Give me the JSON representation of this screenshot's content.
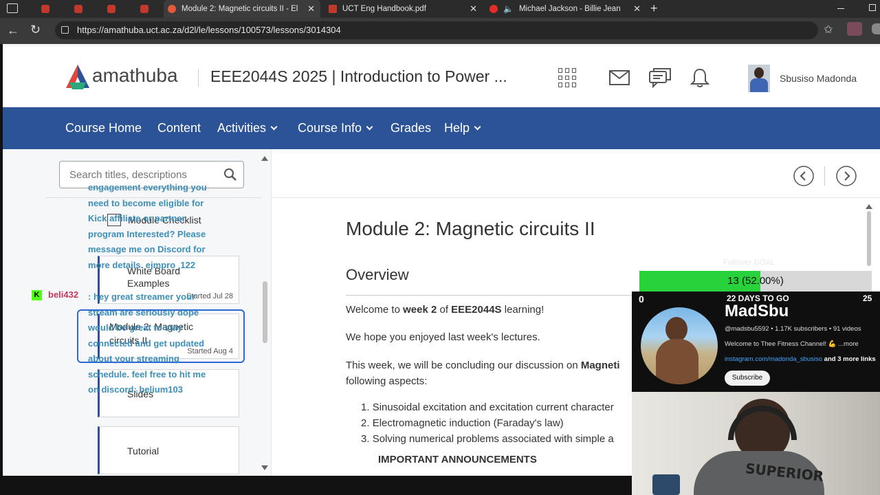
{
  "browser": {
    "tabs": [
      {
        "label": "Module 2: Magnetic circuits II - El",
        "active": true
      },
      {
        "label": "UCT Eng Handbook.pdf",
        "active": false
      },
      {
        "label": "Michael Jackson - Billie Jean",
        "active": false
      }
    ],
    "url": "https://amathuba.uct.ac.za/d2l/le/lessons/100573/lessons/3014304"
  },
  "header": {
    "logo_text": "amathuba",
    "course_title": "EEE2044S 2025 | Introduction to Power ...",
    "user_name": "Sbusiso Madonda"
  },
  "nav": {
    "items": [
      {
        "label": "Course Home",
        "dropdown": false
      },
      {
        "label": "Content",
        "dropdown": false
      },
      {
        "label": "Activities",
        "dropdown": true
      },
      {
        "label": "Course Info",
        "dropdown": true
      },
      {
        "label": "Grades",
        "dropdown": false
      },
      {
        "label": "Help",
        "dropdown": true
      }
    ]
  },
  "sidebar": {
    "search_placeholder": "Search titles, descriptions",
    "items": [
      {
        "label": "Module Checklist",
        "meta": ""
      },
      {
        "label": "White Board Examples",
        "meta": "Started Jul 28"
      },
      {
        "label": "Module 2: Magnetic circuits II",
        "meta": "Started Aug 4"
      },
      {
        "label": "Slides",
        "meta": ""
      },
      {
        "label": "Tutorial",
        "meta": ""
      }
    ]
  },
  "content": {
    "title": "Module 2: Magnetic circuits II",
    "section": "Overview",
    "p1_pre": "Welcome to ",
    "p1_b1": "week 2",
    "p1_mid": " of ",
    "p1_b2": "EEE2044S",
    "p1_post": " learning!",
    "p2": "We hope you enjoyed last week's lectures.",
    "p3_pre": "This week, we will be concluding our discussion on ",
    "p3_b": "Magneti",
    "p3_line2": "following aspects:",
    "list": [
      "Sinusoidal excitation and excitation current character",
      "Electromagnetic induction (Faraday's law)",
      "Solving numerical problems associated with simple a"
    ],
    "announcements": "IMPORTANT ANNOUNCEMENTS"
  },
  "stream": {
    "chat_message": "engagement everything you need to become eligible for Kick affiliate or partner program Interested? Please message me on Discord for more details. ejmpro_122",
    "chat_user": "beli432",
    "chat_user_msg": ": hey great streamer your stream are seriously dope would be great to stay connected and get updated about your streaming schedule. feel free to hit me on discord: belium103",
    "follower_goal_label": "Follower GOAL",
    "goal_text": "13 (52.00%)",
    "goal_fraction": 0.52,
    "goal_min": "0",
    "goal_max": "25",
    "days_to_go": "22 DAYS TO GO",
    "channel_name": "MadSbu",
    "channel_meta": "@madsbu5592 • 1.17K subscribers • 91 videos",
    "channel_desc": "Welcome to Thee Fitness Channel! 💪 ...more",
    "channel_link": "instagram.com/madonda_sbusiso",
    "channel_link_more": " and 3 more links",
    "subscribe_label": "Subscribe",
    "colors": {
      "goal_fill": "#27d23a",
      "chat": "#3d8fb8",
      "chat_user": "#c0395a",
      "nav": "#2b5396"
    }
  }
}
